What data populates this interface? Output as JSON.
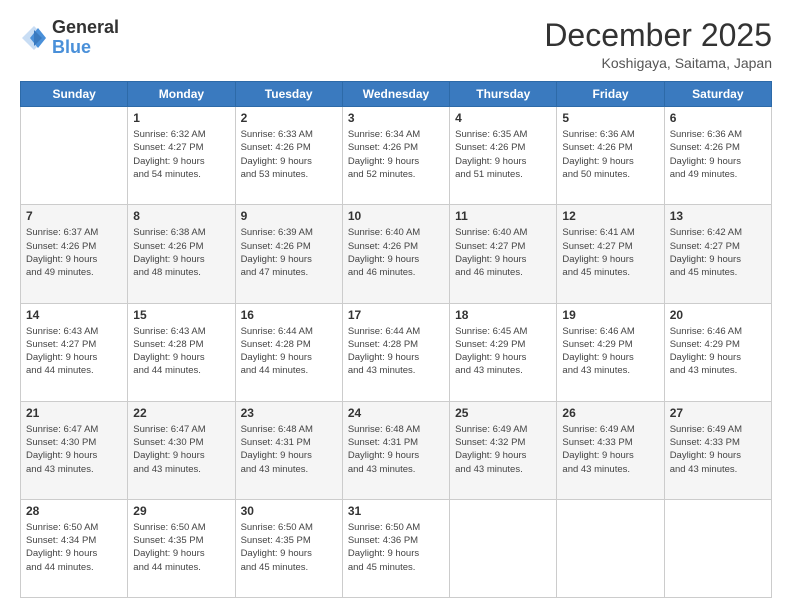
{
  "logo": {
    "line1": "General",
    "line2": "Blue"
  },
  "title": "December 2025",
  "location": "Koshigaya, Saitama, Japan",
  "days_of_week": [
    "Sunday",
    "Monday",
    "Tuesday",
    "Wednesday",
    "Thursday",
    "Friday",
    "Saturday"
  ],
  "weeks": [
    [
      {
        "day": "",
        "info": ""
      },
      {
        "day": "1",
        "info": "Sunrise: 6:32 AM\nSunset: 4:27 PM\nDaylight: 9 hours\nand 54 minutes."
      },
      {
        "day": "2",
        "info": "Sunrise: 6:33 AM\nSunset: 4:26 PM\nDaylight: 9 hours\nand 53 minutes."
      },
      {
        "day": "3",
        "info": "Sunrise: 6:34 AM\nSunset: 4:26 PM\nDaylight: 9 hours\nand 52 minutes."
      },
      {
        "day": "4",
        "info": "Sunrise: 6:35 AM\nSunset: 4:26 PM\nDaylight: 9 hours\nand 51 minutes."
      },
      {
        "day": "5",
        "info": "Sunrise: 6:36 AM\nSunset: 4:26 PM\nDaylight: 9 hours\nand 50 minutes."
      },
      {
        "day": "6",
        "info": "Sunrise: 6:36 AM\nSunset: 4:26 PM\nDaylight: 9 hours\nand 49 minutes."
      }
    ],
    [
      {
        "day": "7",
        "info": "Sunrise: 6:37 AM\nSunset: 4:26 PM\nDaylight: 9 hours\nand 49 minutes."
      },
      {
        "day": "8",
        "info": "Sunrise: 6:38 AM\nSunset: 4:26 PM\nDaylight: 9 hours\nand 48 minutes."
      },
      {
        "day": "9",
        "info": "Sunrise: 6:39 AM\nSunset: 4:26 PM\nDaylight: 9 hours\nand 47 minutes."
      },
      {
        "day": "10",
        "info": "Sunrise: 6:40 AM\nSunset: 4:26 PM\nDaylight: 9 hours\nand 46 minutes."
      },
      {
        "day": "11",
        "info": "Sunrise: 6:40 AM\nSunset: 4:27 PM\nDaylight: 9 hours\nand 46 minutes."
      },
      {
        "day": "12",
        "info": "Sunrise: 6:41 AM\nSunset: 4:27 PM\nDaylight: 9 hours\nand 45 minutes."
      },
      {
        "day": "13",
        "info": "Sunrise: 6:42 AM\nSunset: 4:27 PM\nDaylight: 9 hours\nand 45 minutes."
      }
    ],
    [
      {
        "day": "14",
        "info": "Sunrise: 6:43 AM\nSunset: 4:27 PM\nDaylight: 9 hours\nand 44 minutes."
      },
      {
        "day": "15",
        "info": "Sunrise: 6:43 AM\nSunset: 4:28 PM\nDaylight: 9 hours\nand 44 minutes."
      },
      {
        "day": "16",
        "info": "Sunrise: 6:44 AM\nSunset: 4:28 PM\nDaylight: 9 hours\nand 44 minutes."
      },
      {
        "day": "17",
        "info": "Sunrise: 6:44 AM\nSunset: 4:28 PM\nDaylight: 9 hours\nand 43 minutes."
      },
      {
        "day": "18",
        "info": "Sunrise: 6:45 AM\nSunset: 4:29 PM\nDaylight: 9 hours\nand 43 minutes."
      },
      {
        "day": "19",
        "info": "Sunrise: 6:46 AM\nSunset: 4:29 PM\nDaylight: 9 hours\nand 43 minutes."
      },
      {
        "day": "20",
        "info": "Sunrise: 6:46 AM\nSunset: 4:29 PM\nDaylight: 9 hours\nand 43 minutes."
      }
    ],
    [
      {
        "day": "21",
        "info": "Sunrise: 6:47 AM\nSunset: 4:30 PM\nDaylight: 9 hours\nand 43 minutes."
      },
      {
        "day": "22",
        "info": "Sunrise: 6:47 AM\nSunset: 4:30 PM\nDaylight: 9 hours\nand 43 minutes."
      },
      {
        "day": "23",
        "info": "Sunrise: 6:48 AM\nSunset: 4:31 PM\nDaylight: 9 hours\nand 43 minutes."
      },
      {
        "day": "24",
        "info": "Sunrise: 6:48 AM\nSunset: 4:31 PM\nDaylight: 9 hours\nand 43 minutes."
      },
      {
        "day": "25",
        "info": "Sunrise: 6:49 AM\nSunset: 4:32 PM\nDaylight: 9 hours\nand 43 minutes."
      },
      {
        "day": "26",
        "info": "Sunrise: 6:49 AM\nSunset: 4:33 PM\nDaylight: 9 hours\nand 43 minutes."
      },
      {
        "day": "27",
        "info": "Sunrise: 6:49 AM\nSunset: 4:33 PM\nDaylight: 9 hours\nand 43 minutes."
      }
    ],
    [
      {
        "day": "28",
        "info": "Sunrise: 6:50 AM\nSunset: 4:34 PM\nDaylight: 9 hours\nand 44 minutes."
      },
      {
        "day": "29",
        "info": "Sunrise: 6:50 AM\nSunset: 4:35 PM\nDaylight: 9 hours\nand 44 minutes."
      },
      {
        "day": "30",
        "info": "Sunrise: 6:50 AM\nSunset: 4:35 PM\nDaylight: 9 hours\nand 45 minutes."
      },
      {
        "day": "31",
        "info": "Sunrise: 6:50 AM\nSunset: 4:36 PM\nDaylight: 9 hours\nand 45 minutes."
      },
      {
        "day": "",
        "info": ""
      },
      {
        "day": "",
        "info": ""
      },
      {
        "day": "",
        "info": ""
      }
    ]
  ]
}
